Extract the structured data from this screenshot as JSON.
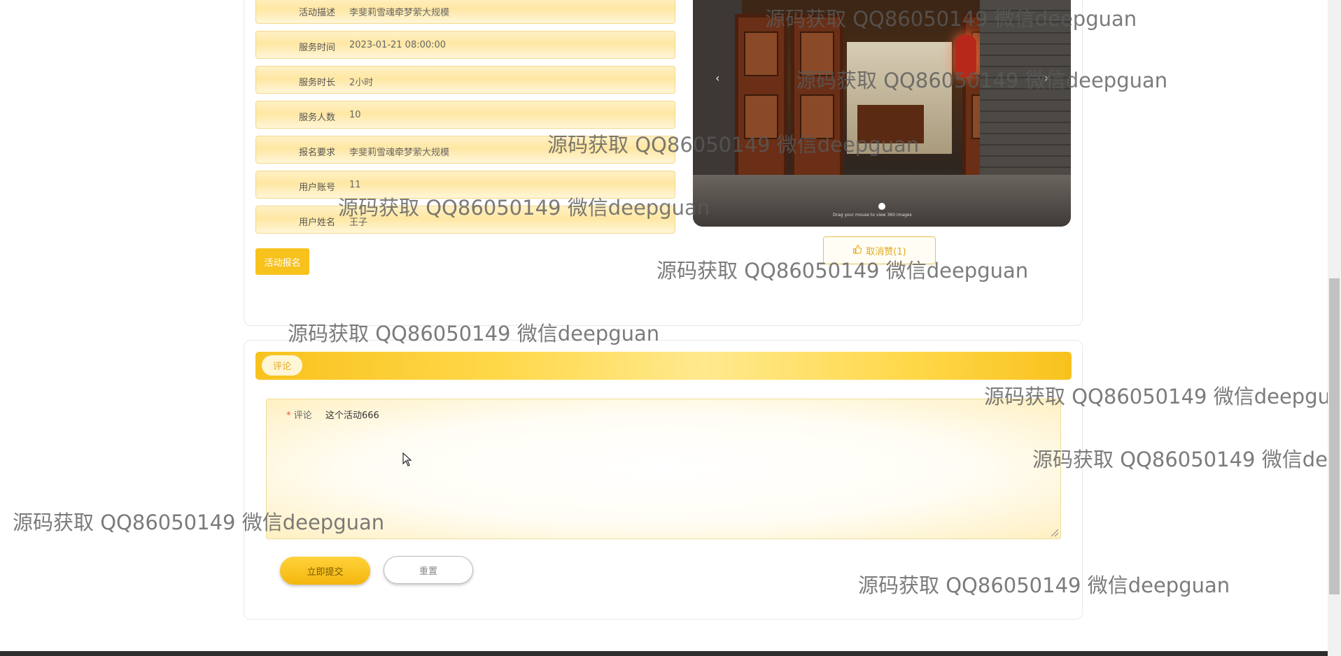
{
  "details": [
    {
      "label": "活动描述",
      "value": "李斐莉雪魂牵梦萦大规模"
    },
    {
      "label": "服务时间",
      "value": "2023-01-21 08:00:00"
    },
    {
      "label": "服务时长",
      "value": "2小时"
    },
    {
      "label": "服务人数",
      "value": "10"
    },
    {
      "label": "报名要求",
      "value": "李斐莉雪魂牵梦萦大规模"
    },
    {
      "label": "用户账号",
      "value": "11"
    },
    {
      "label": "用户姓名",
      "value": "王子"
    }
  ],
  "signup_button": "活动报名",
  "carousel": {
    "prev": "‹",
    "next": "›",
    "caption": "Drag your mouse to view 360 images"
  },
  "like_button": "取消赞(1)",
  "comment": {
    "tab": "评论",
    "required_mark": "*",
    "label": "评论",
    "value": "这个活动666",
    "submit": "立即提交",
    "reset": "重置"
  },
  "watermark": "源码获取 QQ86050149 微信deepguan"
}
